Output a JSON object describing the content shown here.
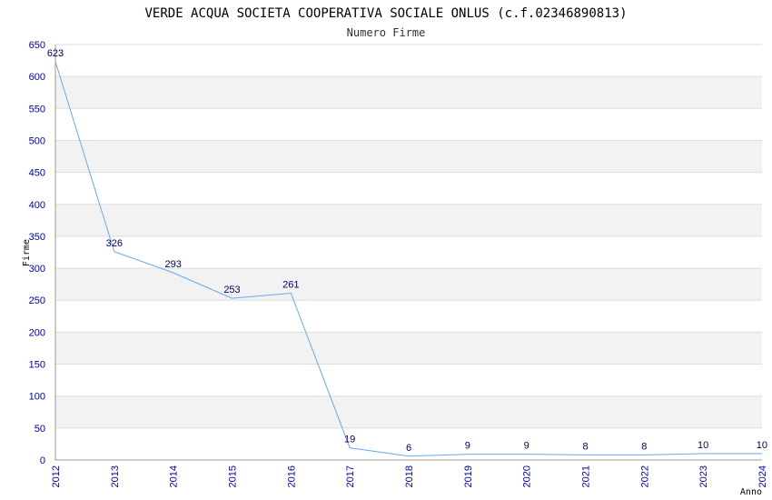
{
  "chart_data": {
    "type": "line",
    "title": "VERDE ACQUA SOCIETA COOPERATIVA SOCIALE ONLUS (c.f.02346890813)",
    "subtitle": "Numero Firme",
    "xlabel": "Anno",
    "ylabel": "Firme",
    "x": [
      "2012",
      "2013",
      "2014",
      "2015",
      "2016",
      "2017",
      "2018",
      "2019",
      "2020",
      "2021",
      "2022",
      "2023",
      "2024"
    ],
    "values": [
      623,
      326,
      293,
      253,
      261,
      19,
      6,
      9,
      9,
      8,
      8,
      10,
      10
    ],
    "ylim": [
      0,
      650
    ],
    "yticks": [
      0,
      50,
      100,
      150,
      200,
      250,
      300,
      350,
      400,
      450,
      500,
      550,
      600,
      650
    ],
    "grid": true,
    "line_color": "#66aaee",
    "tick_color": "#0000aa",
    "band_color": "#f2f2f2"
  }
}
